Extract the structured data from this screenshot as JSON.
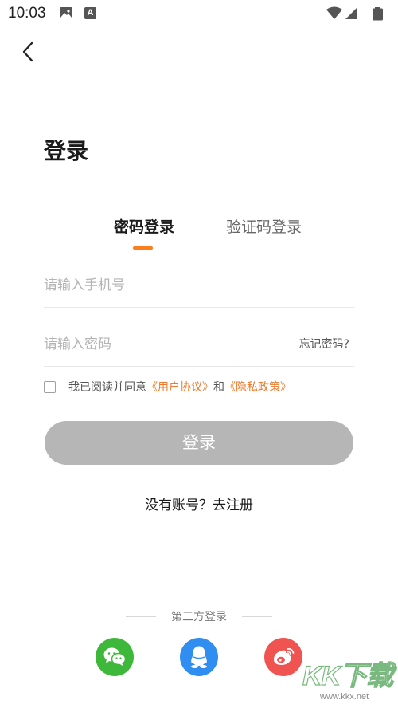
{
  "status_bar": {
    "time": "10:03",
    "a_badge": "A"
  },
  "page": {
    "title": "登录"
  },
  "tabs": [
    {
      "label": "密码登录",
      "active": true
    },
    {
      "label": "验证码登录",
      "active": false
    }
  ],
  "form": {
    "phone_placeholder": "请输入手机号",
    "phone_value": "",
    "password_placeholder": "请输入密码",
    "password_value": "",
    "forgot_label": "忘记密码?"
  },
  "agreement": {
    "checked": false,
    "prefix": "我已阅读并同意",
    "user_agreement": "《用户协议》",
    "and": "和",
    "privacy_policy": "《隐私政策》"
  },
  "login_button": {
    "label": "登录"
  },
  "register": {
    "label": "没有账号？去注册"
  },
  "third_party": {
    "label": "第三方登录",
    "providers": [
      {
        "name": "wechat",
        "icon": "wechat-icon",
        "color": "#3db83a"
      },
      {
        "name": "qq",
        "icon": "qq-icon",
        "color": "#2f8ef0"
      },
      {
        "name": "weibo",
        "icon": "weibo-icon",
        "color": "#ef5450"
      }
    ]
  },
  "watermark": {
    "logo": "KK下载",
    "url": "www.kkx.net"
  },
  "colors": {
    "accent": "#ff7d1a",
    "link": "#ee7a2c",
    "button_disabled": "#b6b6b6"
  }
}
